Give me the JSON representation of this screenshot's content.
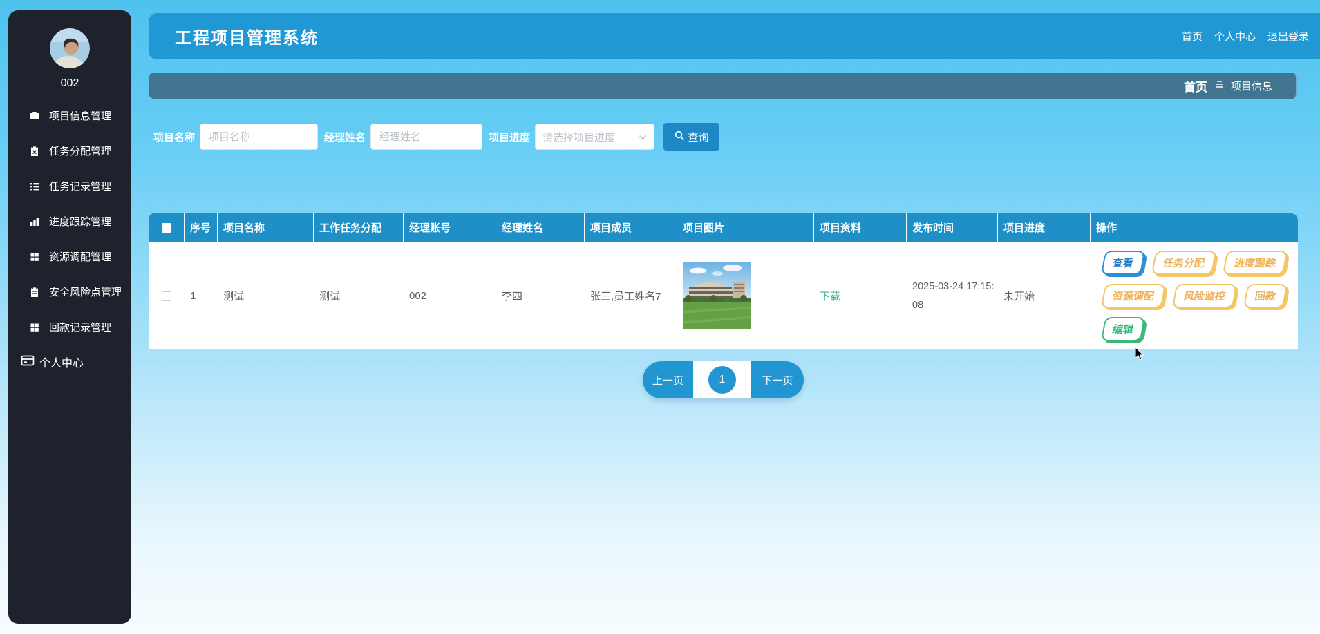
{
  "app": {
    "title": "工程项目管理系统"
  },
  "topnav": {
    "items": [
      {
        "label": "首页"
      },
      {
        "label": "个人中心"
      },
      {
        "label": "退出登录"
      }
    ]
  },
  "breadcrumb": {
    "home": "首页",
    "current": "项目信息"
  },
  "sidebar": {
    "username": "002",
    "items": [
      {
        "label": "项目信息管理",
        "icon": "briefcase-icon"
      },
      {
        "label": "任务分配管理",
        "icon": "clipboard-x-icon"
      },
      {
        "label": "任务记录管理",
        "icon": "list-icon"
      },
      {
        "label": "进度跟踪管理",
        "icon": "bar-chart-icon"
      },
      {
        "label": "资源调配管理",
        "icon": "grid-icon"
      },
      {
        "label": "安全风险点管理",
        "icon": "clipboard-icon"
      },
      {
        "label": "回款记录管理",
        "icon": "grid-icon"
      }
    ],
    "personal_center": {
      "label": "个人中心",
      "icon": "window-icon"
    }
  },
  "filters": {
    "name_label": "项目名称",
    "name_placeholder": "项目名称",
    "manager_label": "经理姓名",
    "manager_placeholder": "经理姓名",
    "progress_label": "项目进度",
    "progress_placeholder": "请选择项目进度",
    "search_label": "查询"
  },
  "table": {
    "headers": [
      "序号",
      "项目名称",
      "工作任务分配",
      "经理账号",
      "经理姓名",
      "项目成员",
      "项目图片",
      "项目资料",
      "发布时间",
      "项目进度",
      "操作"
    ],
    "rows": [
      {
        "index": "1",
        "name": "测试",
        "task": "测试",
        "manager_account": "002",
        "manager_name": "李四",
        "members": "张三,员工姓名7",
        "file_link": "下载",
        "publish_time": "2025-03-24 17:15:08",
        "progress": "未开始",
        "actions": [
          {
            "label": "查看",
            "color": "blue"
          },
          {
            "label": "任务分配",
            "color": "orange"
          },
          {
            "label": "进度跟踪",
            "color": "orange"
          },
          {
            "label": "资源调配",
            "color": "orange"
          },
          {
            "label": "风险监控",
            "color": "orange"
          },
          {
            "label": "回款",
            "color": "orange"
          },
          {
            "label": "编辑",
            "color": "green"
          }
        ]
      }
    ]
  },
  "pagination": {
    "prev": "上一页",
    "current": "1",
    "next": "下一页"
  },
  "colors": {
    "header_blue": "#2098d3",
    "table_header_blue": "#1e8fc7",
    "breadcrumb_blue": "#41758f",
    "search_button_blue": "#1e87c6",
    "pagination_blue": "#2196d3",
    "action_blue": "#2e8ed8",
    "action_orange": "#f6c565",
    "action_green": "#3db87d",
    "download_link_green": "#3cb18f",
    "sidebar_dark": "#1e222c"
  }
}
